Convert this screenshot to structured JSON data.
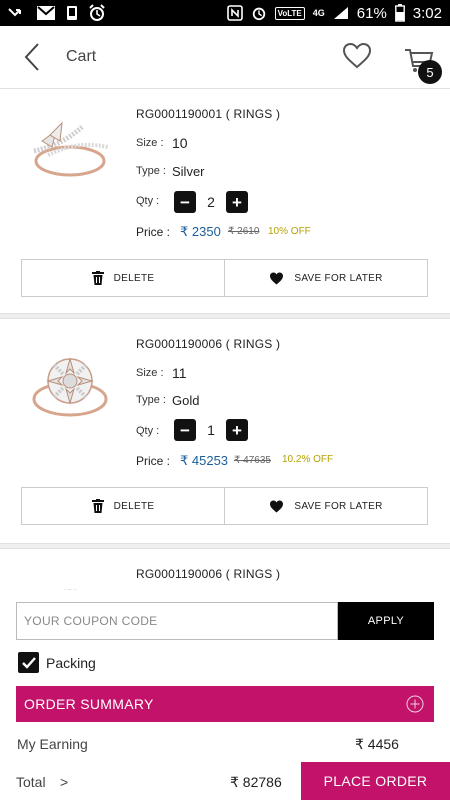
{
  "status_bar": {
    "network": "4G",
    "volte": "VoLTE",
    "battery": "61%",
    "time": "3:02"
  },
  "header": {
    "title": "Cart",
    "cart_count": "5"
  },
  "items": [
    {
      "code": "RG0001190001 ( RINGS )",
      "size_label": "Size :",
      "size": "10",
      "type_label": "Type :",
      "type": "Silver",
      "qty_label": "Qty :",
      "qty": "2",
      "price_label": "Price :",
      "price": "₹ 2350",
      "mrp": "₹ 2610",
      "discount": "10% OFF",
      "delete_label": "DELETE",
      "save_label": "SAVE FOR LATER"
    },
    {
      "code": "RG0001190006 ( RINGS )",
      "size_label": "Size :",
      "size": "11",
      "type_label": "Type :",
      "type": "Gold",
      "qty_label": "Qty :",
      "qty": "1",
      "price_label": "Price :",
      "price": "₹ 45253",
      "mrp": "₹ 47635",
      "discount": "10.2% OFF",
      "delete_label": "DELETE",
      "save_label": "SAVE FOR LATER"
    },
    {
      "code": "RG0001190006 ( RINGS )"
    }
  ],
  "coupon": {
    "placeholder": "YOUR COUPON CODE",
    "apply_label": "APPLY"
  },
  "packing": {
    "label": "Packing",
    "checked": true
  },
  "summary": {
    "title": "ORDER SUMMARY",
    "earning_label": "My Earning",
    "earning_value": "₹ 4456",
    "total_label": "Total",
    "total_chevron": ">",
    "total_value": "₹ 82786",
    "place_order_label": "PLACE ORDER"
  },
  "colors": {
    "accent": "#c2126a",
    "price_blue": "#1b5e9a",
    "discount_gold": "#b5a200"
  }
}
